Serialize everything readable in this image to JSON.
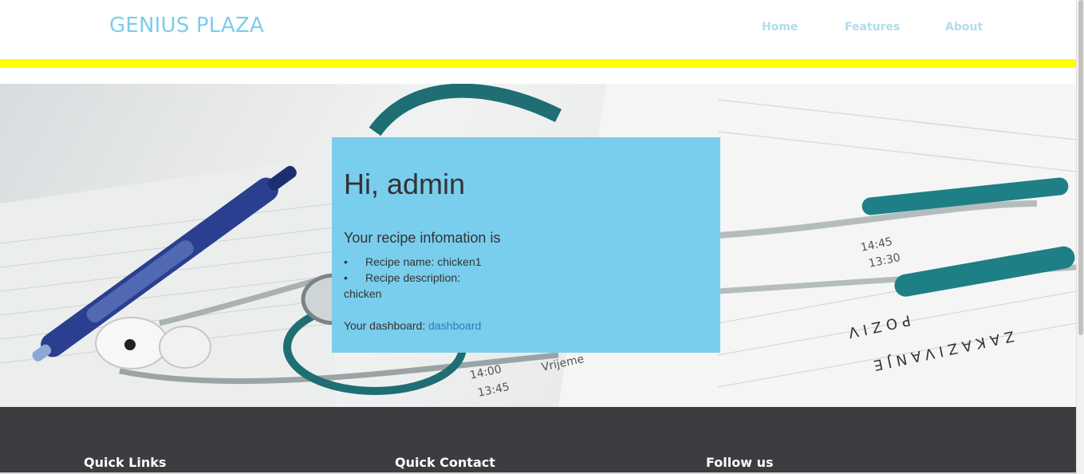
{
  "header": {
    "brand": "GENIUS PLAZA",
    "nav": [
      {
        "label": "Home"
      },
      {
        "label": "Features"
      },
      {
        "label": "About"
      }
    ],
    "accent_color": "#ffff00",
    "brand_color": "#7dcdea"
  },
  "card": {
    "greeting": "Hi, admin",
    "subtitle": "Your recipe infomation is",
    "items": [
      {
        "bullet": "•",
        "text": "Recipe name: chicken1"
      },
      {
        "bullet": "•",
        "text": "Recipe description:"
      }
    ],
    "description_value": "chicken",
    "dashboard_prefix": "Your dashboard: ",
    "dashboard_link": "dashboard",
    "background": "#79cded"
  },
  "footer": {
    "col1": "Quick Links",
    "col2": "Quick Contact",
    "col3": "Follow us"
  }
}
